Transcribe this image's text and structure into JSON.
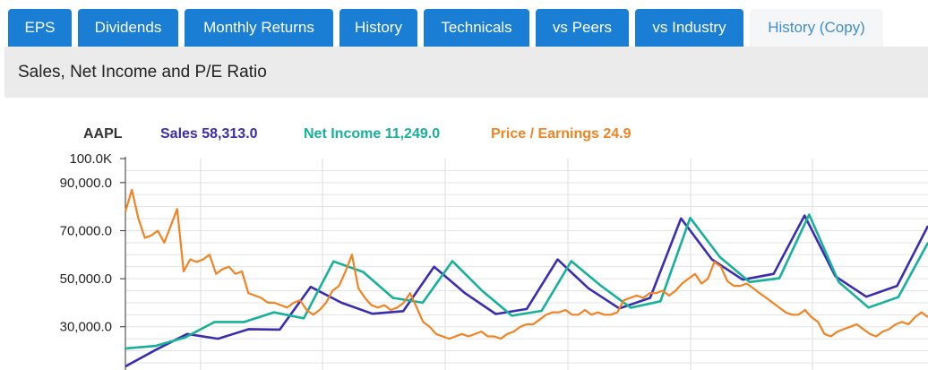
{
  "tabs": [
    {
      "label": "EPS",
      "active": false
    },
    {
      "label": "Dividends",
      "active": false
    },
    {
      "label": "Monthly Returns",
      "active": false
    },
    {
      "label": "History",
      "active": false
    },
    {
      "label": "Technicals",
      "active": false
    },
    {
      "label": "vs Peers",
      "active": false
    },
    {
      "label": "vs Industry",
      "active": false
    },
    {
      "label": "History (Copy)",
      "active": true
    }
  ],
  "page_title": "Sales, Net Income and P/E Ratio",
  "colors": {
    "tab_bg": "#1a7fd4",
    "sales": "#3a2db0",
    "net_income": "#17b09a",
    "pe": "#f28322",
    "ticker": "#333333"
  },
  "chart_data": {
    "type": "line",
    "title": "",
    "ticker": "AAPL",
    "legend": [
      {
        "key": "sales",
        "text": "Sales 58,313.0"
      },
      {
        "key": "net_income",
        "text": "Net Income 11,249.0"
      },
      {
        "key": "pe",
        "text": "Price / Earnings 24.9"
      }
    ],
    "y_ticks": [
      {
        "value": 100000,
        "label": "100.0K"
      },
      {
        "value": 90000,
        "label": "90,000.0"
      },
      {
        "value": 70000,
        "label": "70,000.0"
      },
      {
        "value": 50000,
        "label": "50,000.0"
      },
      {
        "value": 30000,
        "label": "30,000.0"
      }
    ],
    "ylim": [
      12000,
      100000
    ],
    "grid": true,
    "series": [
      {
        "name": "Sales",
        "key": "sales",
        "values": [
          13500,
          20500,
          27000,
          25000,
          29000,
          28800,
          46600,
          40000,
          35400,
          36500,
          55000,
          44000,
          35300,
          37400,
          58000,
          46000,
          37600,
          42000,
          75100,
          58000,
          49600,
          52000,
          76300,
          51000,
          42500,
          47000,
          72000
        ]
      },
      {
        "name": "Net Income",
        "key": "net_income",
        "values": [
          21000,
          22000,
          25500,
          32000,
          32000,
          36000,
          33500,
          57200,
          52800,
          42000,
          40000,
          57300,
          45000,
          34600,
          36600,
          57300,
          47000,
          37900,
          40600,
          75300,
          59000,
          48600,
          50200,
          76700,
          48600,
          38000,
          42300,
          65000
        ]
      },
      {
        "name": "Price / Earnings",
        "key": "pe",
        "values": [
          78000,
          87000,
          75000,
          67000,
          68000,
          70000,
          65000,
          72000,
          79000,
          53000,
          58000,
          57000,
          58000,
          60000,
          52000,
          54000,
          55000,
          52000,
          53000,
          44000,
          43000,
          42000,
          40000,
          40000,
          39000,
          38000,
          40000,
          41000,
          37000,
          35000,
          37000,
          40000,
          45000,
          47000,
          53000,
          60000,
          46000,
          42000,
          39000,
          38000,
          39000,
          37000,
          38000,
          40000,
          44000,
          38000,
          32000,
          30000,
          27000,
          26000,
          25000,
          26000,
          27000,
          26000,
          27000,
          28000,
          26000,
          26000,
          25000,
          27000,
          28000,
          30000,
          31000,
          31000,
          33000,
          35000,
          36000,
          36000,
          37000,
          35000,
          35000,
          37000,
          35000,
          36000,
          35000,
          35000,
          36000,
          41000,
          42000,
          43000,
          42000,
          44000,
          44000,
          45000,
          43000,
          45000,
          48000,
          50000,
          52000,
          48000,
          50000,
          57000,
          55000,
          49000,
          47000,
          47000,
          48000,
          46000,
          44000,
          42000,
          40000,
          38000,
          36000,
          35000,
          35000,
          37000,
          34000,
          32000,
          27000,
          26000,
          28000,
          29000,
          30000,
          31000,
          29000,
          27000,
          26000,
          28000,
          29000,
          31000,
          32000,
          31000,
          34000,
          36000,
          34000
        ]
      }
    ]
  }
}
